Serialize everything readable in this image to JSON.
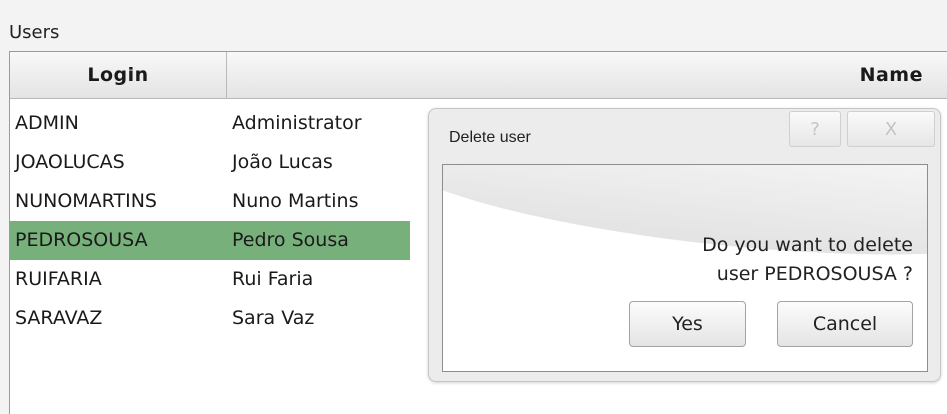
{
  "users_group": {
    "label": "Users",
    "columns": {
      "login": "Login",
      "name": "Name"
    },
    "rows": [
      {
        "login": "ADMIN",
        "name": "Administrator"
      },
      {
        "login": "JOAOLUCAS",
        "name": "João Lucas"
      },
      {
        "login": "NUNOMARTINS",
        "name": "Nuno Martins"
      },
      {
        "login": "PEDROSOUSA",
        "name": "Pedro Sousa"
      },
      {
        "login": "RUIFARIA",
        "name": "Rui Faria"
      },
      {
        "login": "SARAVAZ",
        "name": "Sara Vaz"
      }
    ],
    "selected_index": 3,
    "selected_color": "#77b07a"
  },
  "dialog": {
    "title": "Delete user",
    "title_buttons": {
      "help": "?",
      "close": "X"
    },
    "message_line1": "Do you want to delete",
    "message_line2": "user PEDROSOUSA ?",
    "yes_label": "Yes",
    "cancel_label": "Cancel"
  }
}
